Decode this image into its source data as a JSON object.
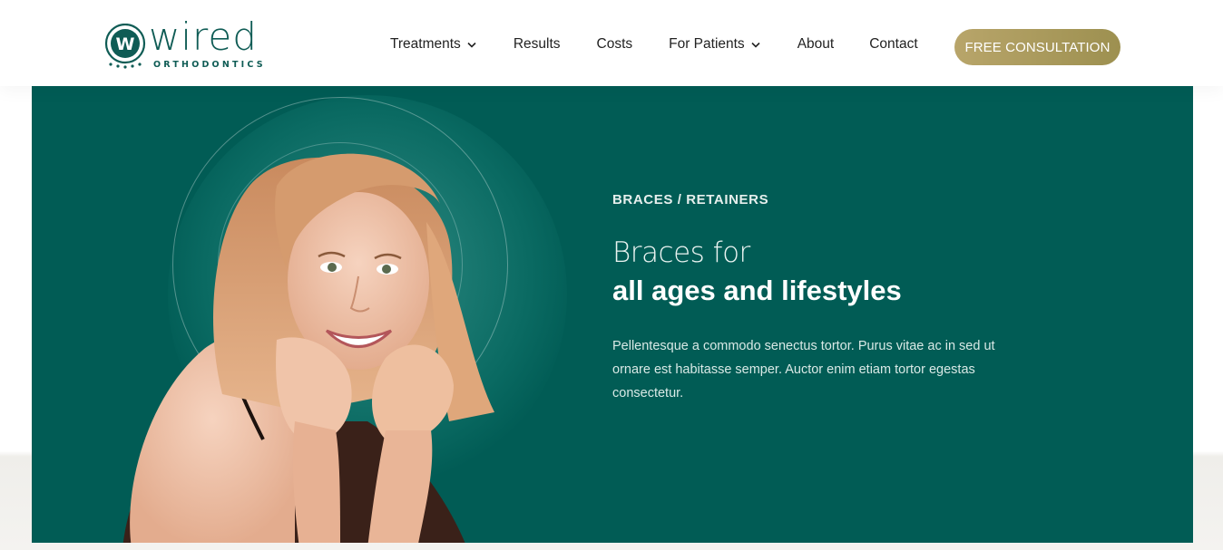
{
  "brand": {
    "name": "wired",
    "tagline": "ORTHODONTICS",
    "mark_letter": "W",
    "primary_color": "#0f5c55",
    "accent_color": "#b0a060"
  },
  "nav": {
    "items": [
      {
        "label": "Treatments",
        "has_dropdown": true,
        "icon": "chevron-down-icon"
      },
      {
        "label": "Results",
        "has_dropdown": false
      },
      {
        "label": "Costs",
        "has_dropdown": false
      },
      {
        "label": "For Patients",
        "has_dropdown": true,
        "icon": "chevron-down-icon"
      },
      {
        "label": "About",
        "has_dropdown": false
      },
      {
        "label": "Contact",
        "has_dropdown": false
      }
    ],
    "cta_label": "FREE CONSULTATION"
  },
  "hero": {
    "eyebrow": "BRACES / RETAINERS",
    "headline_light": "Braces for",
    "headline_bold": "all ages and lifestyles",
    "body": "Pellentesque a commodo senectus tortor. Purus vitae ac in sed ut ornare est habitasse semper. Auctor enim etiam tortor egestas consectetur.",
    "background_color": "#015c55",
    "image": "smiling-woman-photo"
  }
}
